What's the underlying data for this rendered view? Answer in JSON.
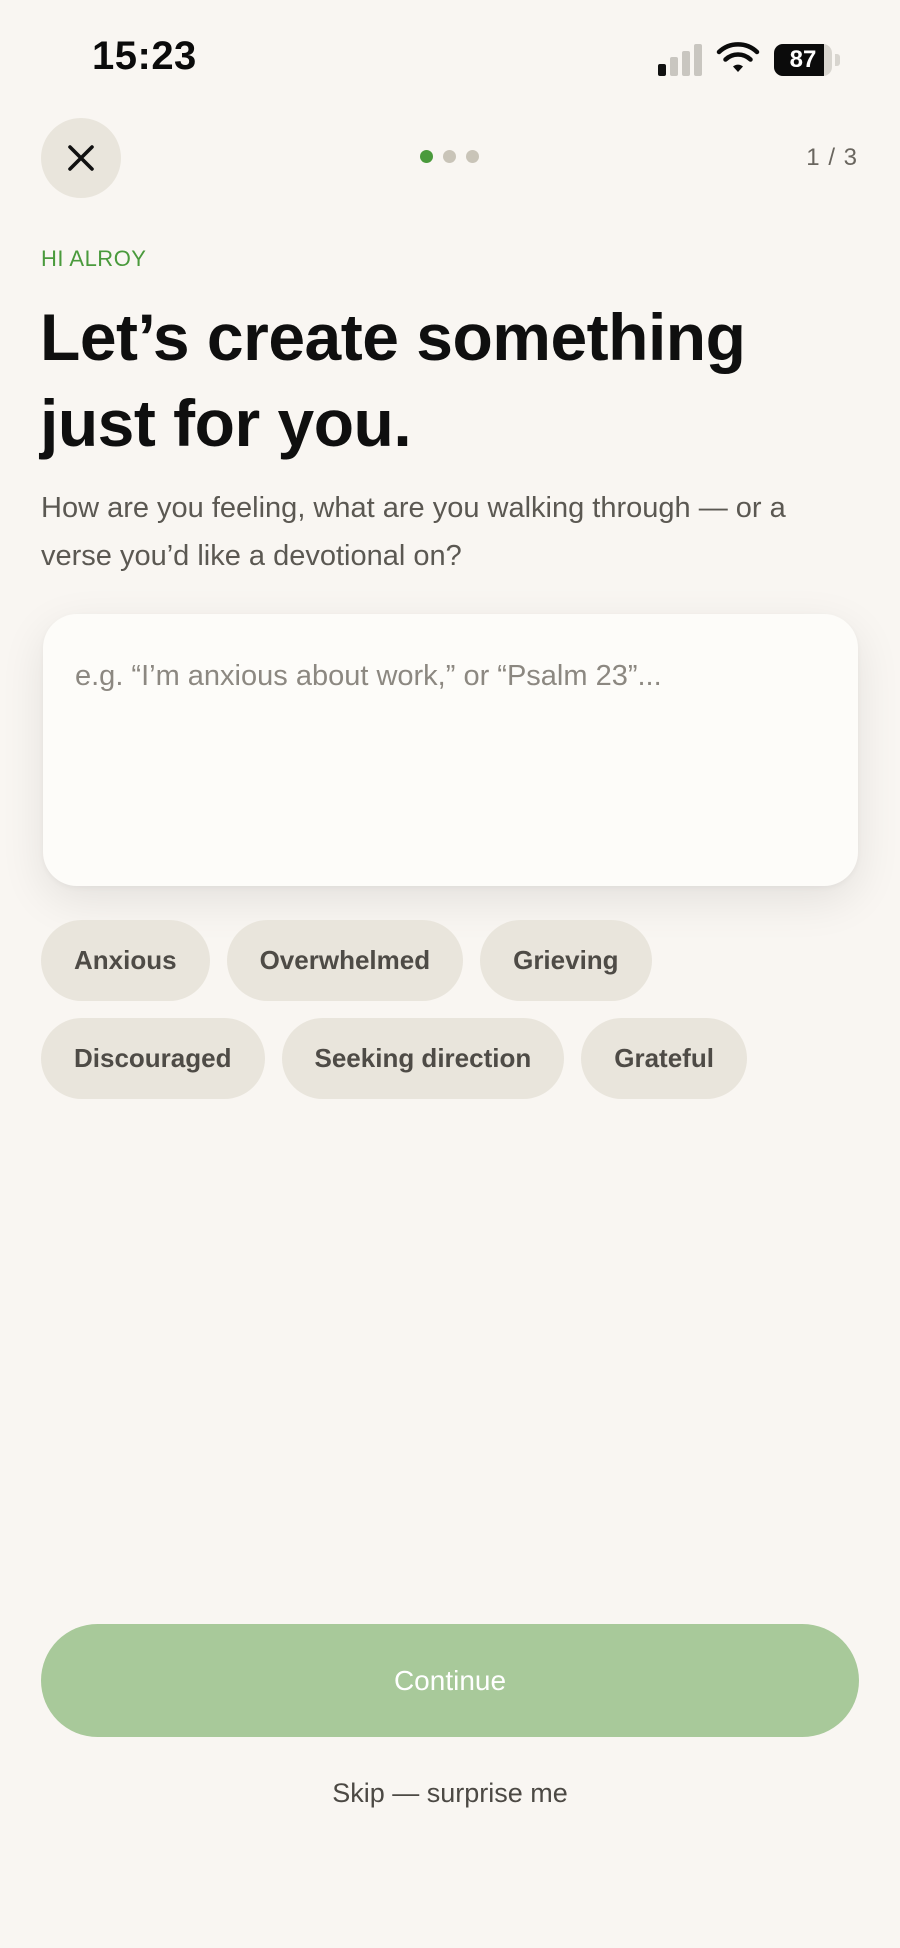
{
  "status_bar": {
    "time": "15:23",
    "battery_level": "87",
    "icons": [
      "signal-icon",
      "wifi-icon",
      "battery-icon"
    ]
  },
  "nav": {
    "close_icon": "close-icon",
    "step_counter": "1 / 3",
    "progress_dots": [
      {
        "state": "active"
      },
      {
        "state": "inactive"
      },
      {
        "state": "inactive"
      }
    ]
  },
  "intro": {
    "greeting": "HI ALROY",
    "headline": "Let’s create something just for you.",
    "subtitle": "How are you feeling, what are you walking through — or a verse you’d like a devotional on?"
  },
  "prompt_input": {
    "value": "",
    "placeholder": "e.g. “I’m anxious about work,” or “Psalm 23”..."
  },
  "mood_chips": [
    [
      "Anxious",
      "Overwhelmed",
      "Grieving"
    ],
    [
      "Discouraged",
      "Seeking direction",
      "Grateful"
    ]
  ],
  "actions": {
    "continue_label": "Continue",
    "skip_label": "Skip — surprise me"
  },
  "colors": {
    "background": "#f9f6f2",
    "accent_green": "#4a9a3c",
    "continue_disabled": "#a8c99a",
    "chip_background": "#e9e5dc"
  }
}
